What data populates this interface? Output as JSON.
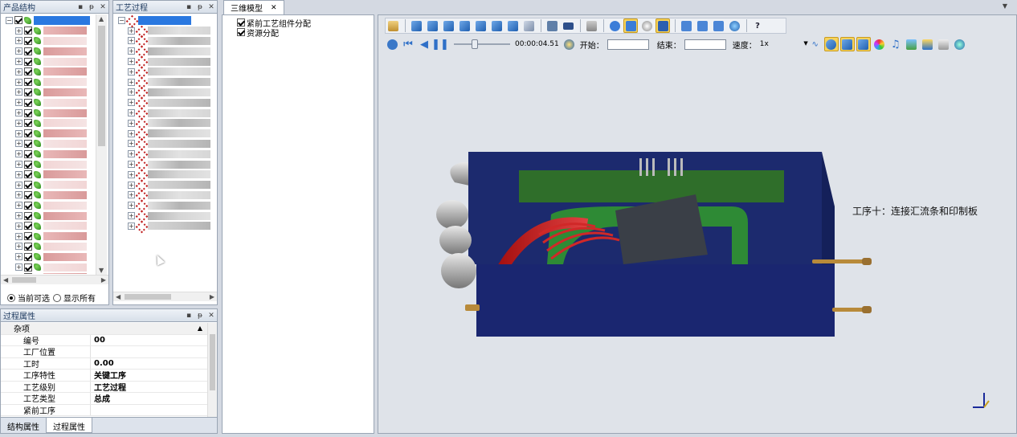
{
  "product_panel": {
    "title": "产品结构",
    "rows": 26,
    "radio_current": "当前可选",
    "radio_all": "显示所有"
  },
  "process_panel": {
    "title": "工艺过程",
    "rows": 21
  },
  "props_panel": {
    "title": "过程属性",
    "category": "杂项",
    "rows": [
      {
        "key": "编号",
        "value": "00"
      },
      {
        "key": "工厂位置",
        "value": ""
      },
      {
        "key": "工时",
        "value": "0.00"
      },
      {
        "key": "工序特性",
        "value": "关键工序"
      },
      {
        "key": "工艺级别",
        "value": "工艺过程"
      },
      {
        "key": "工艺类型",
        "value": "总成"
      },
      {
        "key": "紧前工序",
        "value": ""
      }
    ],
    "tabs": [
      "结构属性",
      "过程属性"
    ]
  },
  "view_tab": {
    "label": "三维模型"
  },
  "assign_list": [
    {
      "label": "紧前工艺组件分配",
      "checked": true
    },
    {
      "label": "资源分配",
      "checked": true
    }
  ],
  "player": {
    "time": "00:00:04.51",
    "start_label": "开始：",
    "end_label": "结束：",
    "speed_label": "速度：",
    "speed_value": "1x"
  },
  "scene": {
    "annotation": "工序十：连接汇流条和印制板"
  },
  "colors": {
    "selection": "#2a78e0",
    "housing": "#1c2a6e",
    "pcb": "#2f6e2a",
    "viewport_bg": "#dfe3e9"
  }
}
